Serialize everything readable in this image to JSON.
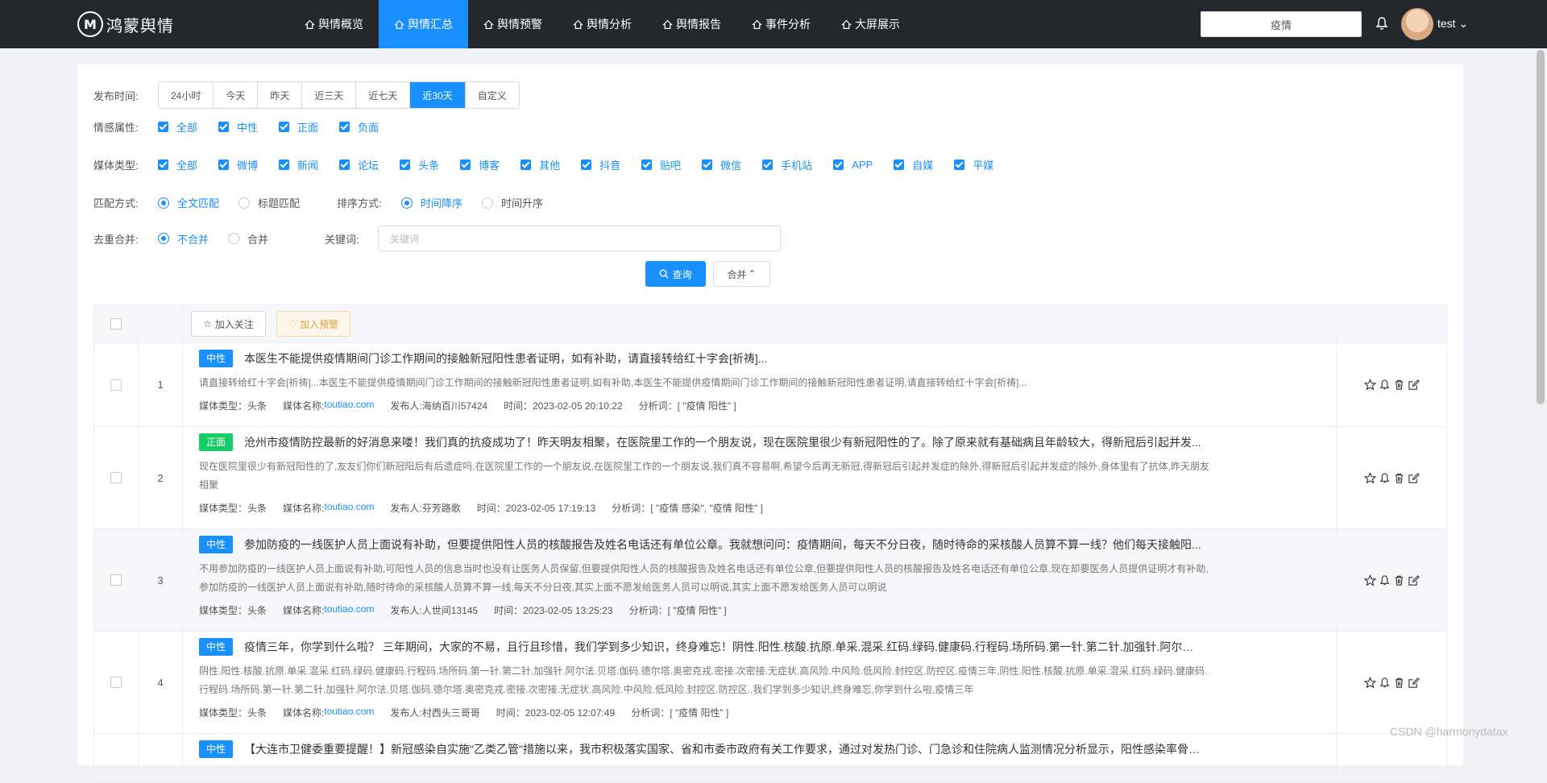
{
  "brand": {
    "logo_letter": "M",
    "name": "鸿蒙舆情"
  },
  "nav": [
    {
      "label": "舆情概览",
      "active": false
    },
    {
      "label": "舆情汇总",
      "active": true
    },
    {
      "label": "舆情预警",
      "active": false
    },
    {
      "label": "舆情分析",
      "active": false
    },
    {
      "label": "舆情报告",
      "active": false
    },
    {
      "label": "事件分析",
      "active": false
    },
    {
      "label": "大屏展示",
      "active": false
    }
  ],
  "search": {
    "value": "疫情"
  },
  "user": {
    "name": "test"
  },
  "filters": {
    "time_label": "发布时间:",
    "time_options": [
      "24小时",
      "今天",
      "昨天",
      "近三天",
      "近七天",
      "近30天",
      "自定义"
    ],
    "time_selected": "近30天",
    "sentiment_label": "情感属性:",
    "sentiment_options": [
      "全部",
      "中性",
      "正面",
      "负面"
    ],
    "media_label": "媒体类型:",
    "media_options": [
      "全部",
      "微博",
      "新闻",
      "论坛",
      "头条",
      "博客",
      "其他",
      "抖音",
      "贴吧",
      "微信",
      "手机站",
      "APP",
      "自媒",
      "平媒"
    ],
    "match_label": "匹配方式:",
    "match_options": [
      "全文匹配",
      "标题匹配"
    ],
    "match_selected": "全文匹配",
    "sort_label": "排序方式:",
    "sort_options": [
      "时间降序",
      "时间升序"
    ],
    "sort_selected": "时间降序",
    "dedup_label": "去重合并:",
    "dedup_options": [
      "不合并",
      "合并"
    ],
    "dedup_selected": "不合并",
    "keyword_label": "关键词:",
    "keyword_placeholder": "关键词"
  },
  "buttons": {
    "query": "查询",
    "merge": "合并",
    "follow": "加入关注",
    "warn": "加入预警"
  },
  "articles": [
    {
      "num": "1",
      "tag": "中性",
      "tag_type": "neutral",
      "title": "本医生不能提供疫情期间门诊工作期间的接触新冠阳性患者证明，如有补助，请直接转给红十字会[祈祷]...",
      "summary": "请直接转给红十字会[祈祷]...本医生不能提供疫情期间门诊工作期间的接触新冠阳性患者证明,如有补助,本医生不能提供疫情期间门诊工作期间的接触新冠阳性患者证明,请直接转给红十字会[祈祷]...",
      "media_type": "媒体类型：头条",
      "media_name_label": "媒体名称:",
      "media_name": "toutiao.com",
      "publisher": "发布人:海纳百川57424",
      "time": "时间：2023-02-05 20:10:22",
      "words": "分析词：[ \"疫情 阳性\" ]"
    },
    {
      "num": "2",
      "tag": "正面",
      "tag_type": "positive",
      "title": "沧州市疫情防控最新的好消息来喽！我们真的抗疫成功了！昨天明友相聚，在医院里工作的一个朋友说，现在医院里很少有新冠阳性的了。除了原来就有基础病且年龄较大，得新冠后引起并发...",
      "summary": "现在医院里很少有新冠阳性的了,友友们你们新冠阳后有后遗症吗,在医院里工作的一个朋友说,在医院里工作的一个朋友说,我们真不容易啊,希望今后再无新冠,得新冠后引起并发症的除外,得新冠后引起并发症的除外,身体里有了抗体,昨天朋友相聚",
      "media_type": "媒体类型：头条",
      "media_name_label": "媒体名称:",
      "media_name": "toutiao.com",
      "publisher": "发布人:芬芳路歌",
      "time": "时间：2023-02-05 17:19:13",
      "words": "分析词：[ \"疫情 感染\", \"疫情 阳性\" ]"
    },
    {
      "num": "3",
      "tag": "中性",
      "tag_type": "neutral",
      "title": "参加防疫的一线医护人员上面说有补助，但要提供阳性人员的核酸报告及姓名电话还有单位公章。我就想问问：疫情期间，每天不分日夜，随时待命的采核酸人员算不算一线？他们每天接触阳...",
      "summary": "不用参加防疫的一线医护人员上面说有补助,可阳性人员的信息当时也没有让医务人员保留,但要提供阳性人员的核酸报告及姓名电话还有单位公章,但要提供阳性人员的核酸报告及姓名电话还有单位公章,现在却要医务人员提供证明才有补助,参加防疫的一线医护人员上面说有补助,随时待命的采核酸人员算不算一线,每天不分日夜,其实上面不愿发给医务人员可以明说,其实上面不愿发给医务人员可以明说",
      "media_type": "媒体类型：头条",
      "media_name_label": "媒体名称:",
      "media_name": "toutiao.com",
      "publisher": "发布人:人世间13145",
      "time": "时间：2023-02-05 13:25:23",
      "words": "分析词：[ \"疫情 阳性\" ]"
    },
    {
      "num": "4",
      "tag": "中性",
      "tag_type": "neutral",
      "title": "疫情三年，你学到什么啦？ 三年期间，大家的不易，且行且珍惜，我们学到多少知识，终身难忘！阴性.阳性.核酸.抗原.单采.混采.红码.绿码.健康码.行程码.场所码.第一针.第二针.加强针.阿尔法....",
      "summary": "阴性.阳性.核酸.抗原.单采.混采.红码.绿码.健康码.行程码.场所码.第一针.第二针.加强针.阿尔法.贝塔.伽码.德尔塔.奥密克戎.密接.次密接.无症状.高风险.中风险.低风险.封控区.防控区.疫情三年,阴性.阳性.核酸.抗原.单采.混采.红码.绿码.健康码.行程码.场所码.第一针.第二针.加强针.阿尔法.贝塔.伽码.德尔塔.奥密克戎.密接.次密接.无症状.高风险.中风险.低风险.封控区.防控区.,我们学到多少知识,终身难忘,你学到什么啦,疫情三年",
      "media_type": "媒体类型：头条",
      "media_name_label": "媒体名称:",
      "media_name": "toutiao.com",
      "publisher": "发布人:村西头三哥哥",
      "time": "时间：2023-02-05 12:07:49",
      "words": "分析词：[ \"疫情 阳性\" ]"
    },
    {
      "num": "5",
      "tag": "中性",
      "tag_type": "neutral",
      "title": "【大连市卫健委重要提醒！】新冠感染自实施\"乙类乙管\"措施以来，我市积极落实国家、省和市委市政府有关工作要求，通过对发热门诊、门急诊和住院病人监测情况分析显示，阳性感染率骨明...",
      "summary": "",
      "media_type": "",
      "media_name_label": "",
      "media_name": "",
      "publisher": "",
      "time": "",
      "words": ""
    }
  ],
  "watermark": "CSDN @harmonydatax"
}
